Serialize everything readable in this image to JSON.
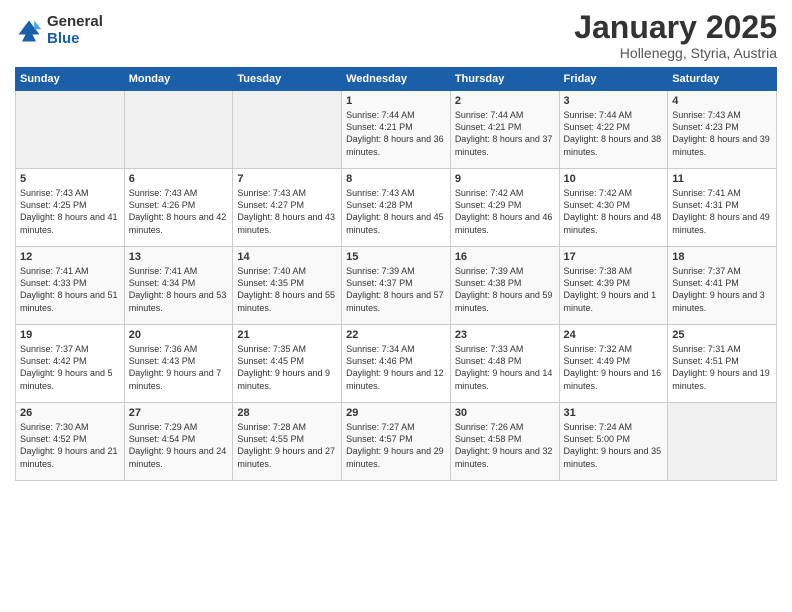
{
  "logo": {
    "general": "General",
    "blue": "Blue"
  },
  "header": {
    "month": "January 2025",
    "location": "Hollenegg, Styria, Austria"
  },
  "weekdays": [
    "Sunday",
    "Monday",
    "Tuesday",
    "Wednesday",
    "Thursday",
    "Friday",
    "Saturday"
  ],
  "weeks": [
    [
      {
        "day": "",
        "content": ""
      },
      {
        "day": "",
        "content": ""
      },
      {
        "day": "",
        "content": ""
      },
      {
        "day": "1",
        "content": "Sunrise: 7:44 AM\nSunset: 4:21 PM\nDaylight: 8 hours and 36 minutes."
      },
      {
        "day": "2",
        "content": "Sunrise: 7:44 AM\nSunset: 4:21 PM\nDaylight: 8 hours and 37 minutes."
      },
      {
        "day": "3",
        "content": "Sunrise: 7:44 AM\nSunset: 4:22 PM\nDaylight: 8 hours and 38 minutes."
      },
      {
        "day": "4",
        "content": "Sunrise: 7:43 AM\nSunset: 4:23 PM\nDaylight: 8 hours and 39 minutes."
      }
    ],
    [
      {
        "day": "5",
        "content": "Sunrise: 7:43 AM\nSunset: 4:25 PM\nDaylight: 8 hours and 41 minutes."
      },
      {
        "day": "6",
        "content": "Sunrise: 7:43 AM\nSunset: 4:26 PM\nDaylight: 8 hours and 42 minutes."
      },
      {
        "day": "7",
        "content": "Sunrise: 7:43 AM\nSunset: 4:27 PM\nDaylight: 8 hours and 43 minutes."
      },
      {
        "day": "8",
        "content": "Sunrise: 7:43 AM\nSunset: 4:28 PM\nDaylight: 8 hours and 45 minutes."
      },
      {
        "day": "9",
        "content": "Sunrise: 7:42 AM\nSunset: 4:29 PM\nDaylight: 8 hours and 46 minutes."
      },
      {
        "day": "10",
        "content": "Sunrise: 7:42 AM\nSunset: 4:30 PM\nDaylight: 8 hours and 48 minutes."
      },
      {
        "day": "11",
        "content": "Sunrise: 7:41 AM\nSunset: 4:31 PM\nDaylight: 8 hours and 49 minutes."
      }
    ],
    [
      {
        "day": "12",
        "content": "Sunrise: 7:41 AM\nSunset: 4:33 PM\nDaylight: 8 hours and 51 minutes."
      },
      {
        "day": "13",
        "content": "Sunrise: 7:41 AM\nSunset: 4:34 PM\nDaylight: 8 hours and 53 minutes."
      },
      {
        "day": "14",
        "content": "Sunrise: 7:40 AM\nSunset: 4:35 PM\nDaylight: 8 hours and 55 minutes."
      },
      {
        "day": "15",
        "content": "Sunrise: 7:39 AM\nSunset: 4:37 PM\nDaylight: 8 hours and 57 minutes."
      },
      {
        "day": "16",
        "content": "Sunrise: 7:39 AM\nSunset: 4:38 PM\nDaylight: 8 hours and 59 minutes."
      },
      {
        "day": "17",
        "content": "Sunrise: 7:38 AM\nSunset: 4:39 PM\nDaylight: 9 hours and 1 minute."
      },
      {
        "day": "18",
        "content": "Sunrise: 7:37 AM\nSunset: 4:41 PM\nDaylight: 9 hours and 3 minutes."
      }
    ],
    [
      {
        "day": "19",
        "content": "Sunrise: 7:37 AM\nSunset: 4:42 PM\nDaylight: 9 hours and 5 minutes."
      },
      {
        "day": "20",
        "content": "Sunrise: 7:36 AM\nSunset: 4:43 PM\nDaylight: 9 hours and 7 minutes."
      },
      {
        "day": "21",
        "content": "Sunrise: 7:35 AM\nSunset: 4:45 PM\nDaylight: 9 hours and 9 minutes."
      },
      {
        "day": "22",
        "content": "Sunrise: 7:34 AM\nSunset: 4:46 PM\nDaylight: 9 hours and 12 minutes."
      },
      {
        "day": "23",
        "content": "Sunrise: 7:33 AM\nSunset: 4:48 PM\nDaylight: 9 hours and 14 minutes."
      },
      {
        "day": "24",
        "content": "Sunrise: 7:32 AM\nSunset: 4:49 PM\nDaylight: 9 hours and 16 minutes."
      },
      {
        "day": "25",
        "content": "Sunrise: 7:31 AM\nSunset: 4:51 PM\nDaylight: 9 hours and 19 minutes."
      }
    ],
    [
      {
        "day": "26",
        "content": "Sunrise: 7:30 AM\nSunset: 4:52 PM\nDaylight: 9 hours and 21 minutes."
      },
      {
        "day": "27",
        "content": "Sunrise: 7:29 AM\nSunset: 4:54 PM\nDaylight: 9 hours and 24 minutes."
      },
      {
        "day": "28",
        "content": "Sunrise: 7:28 AM\nSunset: 4:55 PM\nDaylight: 9 hours and 27 minutes."
      },
      {
        "day": "29",
        "content": "Sunrise: 7:27 AM\nSunset: 4:57 PM\nDaylight: 9 hours and 29 minutes."
      },
      {
        "day": "30",
        "content": "Sunrise: 7:26 AM\nSunset: 4:58 PM\nDaylight: 9 hours and 32 minutes."
      },
      {
        "day": "31",
        "content": "Sunrise: 7:24 AM\nSunset: 5:00 PM\nDaylight: 9 hours and 35 minutes."
      },
      {
        "day": "",
        "content": ""
      }
    ]
  ]
}
